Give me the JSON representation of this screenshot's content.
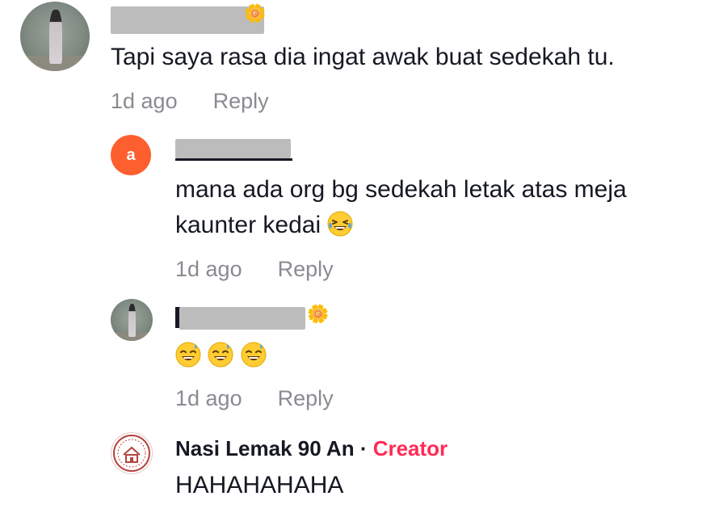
{
  "comments": [
    {
      "username": "",
      "username_flower": "🌼",
      "text": "Tapi saya rasa dia ingat awak buat sedekah tu.",
      "time": "1d ago",
      "reply_label": "Reply"
    },
    {
      "avatar_letter": "a",
      "username": "",
      "text_line1": "mana ada org bg sedekah letak atas meja",
      "text_line2": "kaunter kedai",
      "text_emoji": "grinning-squinting-tears-emoji",
      "time": "1d ago",
      "reply_label": "Reply"
    },
    {
      "username": "",
      "username_flower": "🌼",
      "text_emojis": [
        "grinning-sweat-emoji",
        "grinning-sweat-emoji",
        "grinning-sweat-emoji"
      ],
      "time": "1d ago",
      "reply_label": "Reply"
    },
    {
      "username": "Nasi Lemak 90 An",
      "separator": " · ",
      "creator_label": "Creator",
      "text": "HAHAHAHAHA"
    }
  ],
  "colors": {
    "creator": "#fe2c55",
    "avatar_letter_bg": "#fe5f2f",
    "meta_text": "#8a8b91",
    "primary_text": "#161823"
  }
}
